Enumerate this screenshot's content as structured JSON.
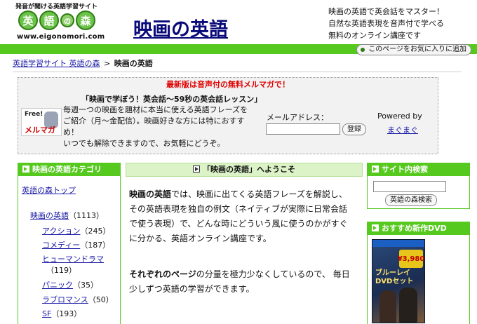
{
  "header": {
    "logo": {
      "tagline": "発音が聞ける英語学習サイト",
      "chars": [
        "英",
        "語",
        "の",
        "森"
      ],
      "url": "www.eigonomori.com"
    },
    "site_title": "映画の英語",
    "description": [
      "映画の英語で英会話をマスター！",
      "自然な英語表現を音声付で学べる",
      "無料のオンライン講座です"
    ],
    "bookmark_label": "このページをお気に入りに追加"
  },
  "breadcrumb": {
    "home": "英語学習サイト 英語の森",
    "separator": ">",
    "current": "映画の英語"
  },
  "mail_magazine": {
    "headline": "最新版は音声付の無料メルマガで！",
    "badge_free": "Free!",
    "badge_label": "メルマガ",
    "title": "「映画で学ぼう！英会話～59秒の英会話レッスン」",
    "description": [
      "毎週一つの映画を題材に本当に使える英語フレーズを",
      "ご紹介（月～金配信）。映画好きな方には特におすす",
      "め！",
      "いつでも解除できますので、お気軽にどうぞ。"
    ],
    "email_label": "メールアドレス：",
    "email_value": "",
    "register_label": "登録",
    "powered_by": "Powered by",
    "powered_link": "まぐまぐ"
  },
  "sidebar": {
    "heading": "映画の英語カテゴリ",
    "top_link": "英語の森トップ",
    "categories": [
      {
        "label": "映画の英語",
        "count": "（1113）"
      },
      {
        "label": "アクション",
        "count": "（245）"
      },
      {
        "label": "コメディー",
        "count": "（187）"
      },
      {
        "label": "ヒューマンドラマ",
        "count": "（119）"
      },
      {
        "label": "パニック",
        "count": "（35）"
      },
      {
        "label": "ラブロマンス",
        "count": "（50）"
      },
      {
        "label": "SF",
        "count": "（193）"
      }
    ]
  },
  "main": {
    "heading": "「映画の英語」へようこそ",
    "para1_bold": "映画の英語",
    "para1_lines": [
      "では、映画に出てくる英語フレーズを解説し、",
      "その英語表現を独自の例文（ネイティブが実際に日常会話",
      "で使う表現）で、どんな時にどういう風に使うのかがすぐ",
      "に分かる、英語オンライン講座です。"
    ],
    "para2_bold": "それぞれのページ",
    "para2_lines": [
      "の分量を極力少なくしているので、 毎日",
      "少しずつ英語の学習ができます。"
    ]
  },
  "right": {
    "search_heading": "サイト内検索",
    "search_value": "",
    "search_button": "英語の森検索",
    "dvd_heading": "おすすめ新作DVD",
    "dvd_title": "ブルーレイ DVDセット",
    "dvd_price": "¥3,980"
  },
  "colors": {
    "brand_green": "#56c91e",
    "title_blue": "#0a0a7a",
    "headline_red": "#e00000"
  }
}
